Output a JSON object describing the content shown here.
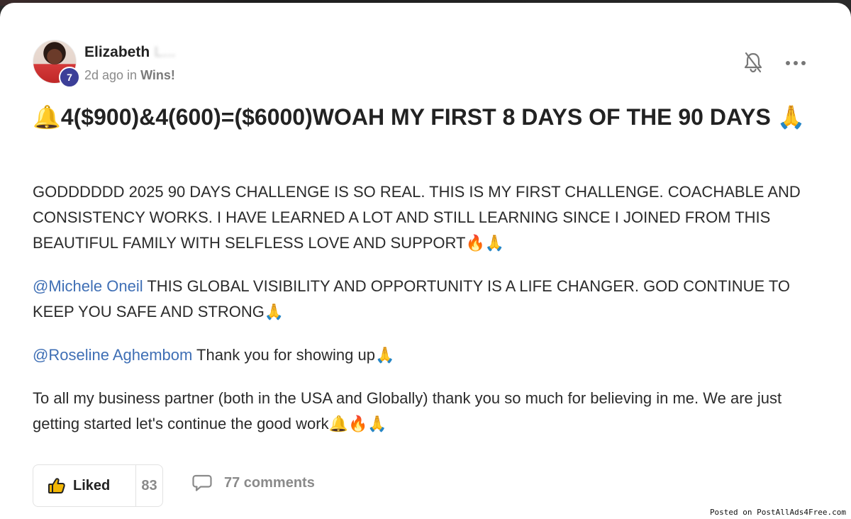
{
  "post": {
    "author": {
      "name": "Elizabeth",
      "name_hidden": "L...",
      "level": "7"
    },
    "meta": {
      "time": "2d ago in ",
      "category": "Wins!"
    },
    "title": "🔔4($900)&4(600)=($6000)WOAH MY FIRST 8 DAYS OF THE 90 DAYS 🙏",
    "paragraphs": {
      "p1": "GODDDDDD 2025 90 DAYS CHALLENGE IS SO REAL. THIS IS MY FIRST CHALLENGE. COACHABLE AND CONSISTENCY WORKS. I HAVE LEARNED A LOT AND STILL LEARNING SINCE I JOINED FROM THIS BEAUTIFUL FAMILY WITH SELFLESS LOVE AND SUPPORT🔥🙏",
      "p2_mention": "@Michele Oneil",
      "p2_text": " THIS GLOBAL VISIBILITY AND OPPORTUNITY IS A LIFE CHANGER. GOD CONTINUE TO KEEP YOU SAFE AND STRONG🙏",
      "p3_mention": "@Roseline Aghembom",
      "p3_text": " Thank you for showing up🙏",
      "p4": "To all my business partner (both in the USA and Globally) thank you so much for believing in me. We are just getting started let's continue the good work🔔🔥🙏"
    },
    "actions": {
      "liked_label": "Liked",
      "like_count": "83",
      "comments_label": "77 comments"
    },
    "icons": {
      "bell": "bell-off-icon",
      "more": "more-horizontal-icon",
      "like": "thumbs-up-icon",
      "comment": "comment-icon"
    }
  },
  "watermark": "Posted on PostAllAds4Free.com",
  "colors": {
    "mention": "#3f6fb5",
    "badge": "#3c3f98",
    "text": "#222222",
    "muted": "#8a8a8a"
  }
}
